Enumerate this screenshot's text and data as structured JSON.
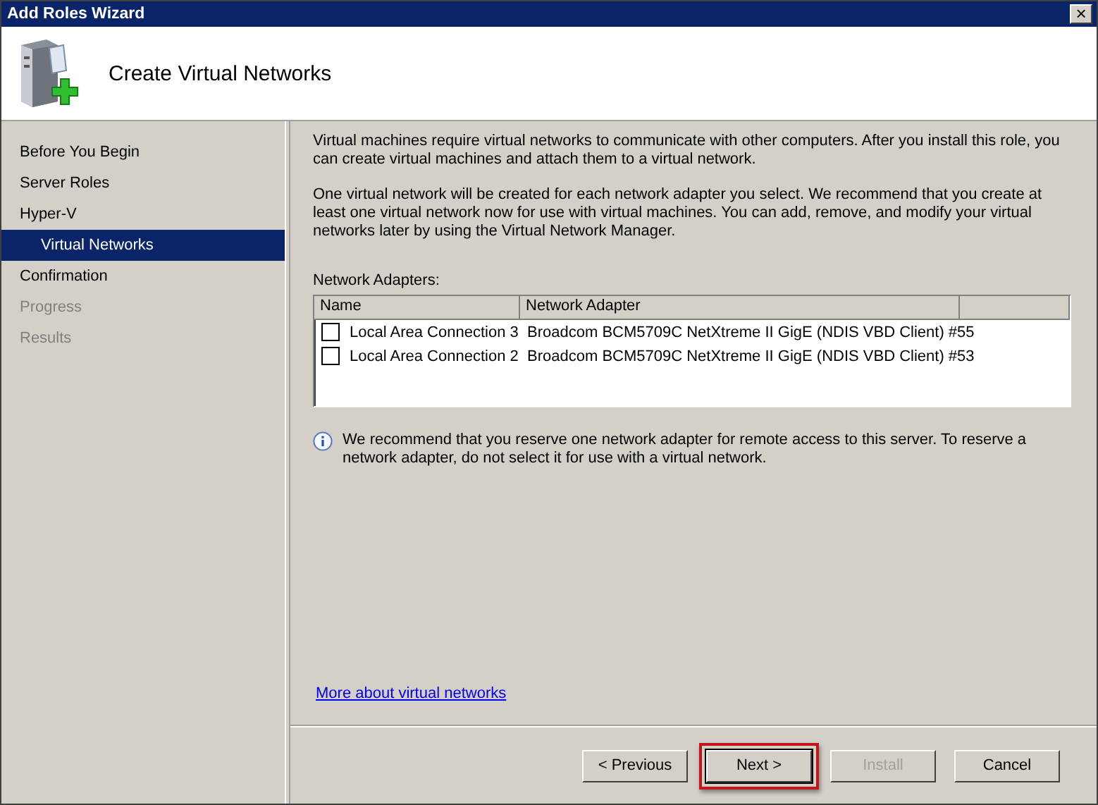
{
  "window": {
    "title": "Add Roles Wizard",
    "close": "×"
  },
  "header": {
    "title": "Create Virtual Networks"
  },
  "steps": [
    {
      "label": "Before You Begin",
      "selected": false,
      "disabled": false
    },
    {
      "label": "Server Roles",
      "selected": false,
      "disabled": false
    },
    {
      "label": "Hyper-V",
      "selected": false,
      "disabled": false,
      "children": [
        {
          "label": "Virtual Networks",
          "selected": true,
          "disabled": false
        }
      ]
    },
    {
      "label": "Confirmation",
      "selected": false,
      "disabled": false
    },
    {
      "label": "Progress",
      "selected": false,
      "disabled": true
    },
    {
      "label": "Results",
      "selected": false,
      "disabled": true
    }
  ],
  "intro": [
    "Virtual machines require virtual networks to communicate with other computers. After you install this role, you can create virtual machines and attach them to a virtual network.",
    "One virtual network will be created for each network adapter you select. We recommend that you create at least one virtual network now for use with virtual machines. You can add, remove, and modify your virtual networks later by using the Virtual Network Manager."
  ],
  "adapters": {
    "label": "Network Adapters:",
    "columns": [
      "Name",
      "Network Adapter"
    ],
    "rows": [
      {
        "name": "Local Area Connection 3",
        "adapter": "Broadcom BCM5709C NetXtreme II GigE (NDIS VBD Client) #55",
        "checked": false
      },
      {
        "name": "Local Area Connection 2",
        "adapter": "Broadcom BCM5709C NetXtreme II GigE (NDIS VBD Client) #53",
        "checked": false
      }
    ]
  },
  "info": "We recommend that you reserve one network adapter for remote access to this server. To reserve a network adapter, do not select it for use with a virtual network.",
  "link": "More about virtual networks",
  "buttons": [
    {
      "label": "< Previous",
      "disabled": false,
      "highlighted": false
    },
    {
      "label": "Next >",
      "disabled": false,
      "highlighted": true
    },
    {
      "label": "Install",
      "disabled": true,
      "highlighted": false
    },
    {
      "label": "Cancel",
      "disabled": false,
      "highlighted": false
    }
  ]
}
